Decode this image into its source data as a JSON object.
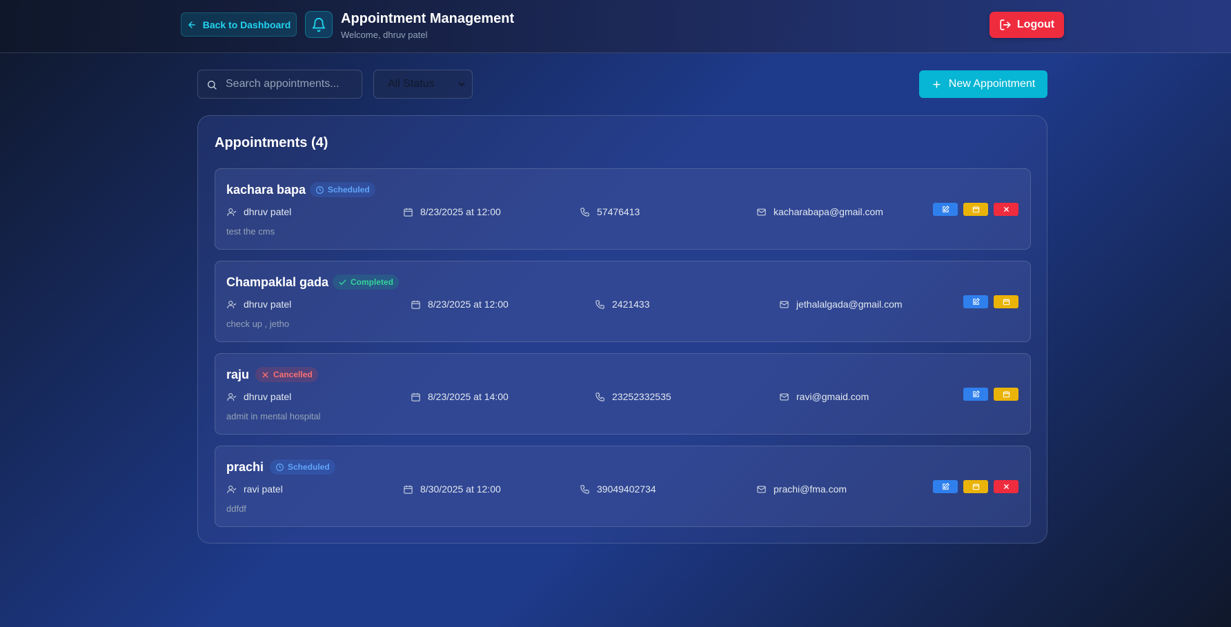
{
  "header": {
    "back_label": "Back to Dashboard",
    "title": "Appointment Management",
    "welcome": "Welcome, dhruv patel",
    "logout_label": "Logout"
  },
  "toolbar": {
    "search_placeholder": "Search appointments...",
    "status_selected": "All Status",
    "new_label": "New Appointment"
  },
  "list": {
    "title": "Appointments (4)",
    "items": [
      {
        "name": "kachara bapa",
        "status": "Scheduled",
        "doctor": "dhruv patel",
        "datetime": "8/23/2025 at 12:00",
        "phone": "57476413",
        "email": "kacharabapa@gmail.com",
        "note": "test the cms"
      },
      {
        "name": "Champaklal gada",
        "status": "Completed",
        "doctor": "dhruv patel",
        "datetime": "8/23/2025 at 12:00",
        "phone": "2421433",
        "email": "jethalalgada@gmail.com",
        "note": "check up , jetho"
      },
      {
        "name": "raju",
        "status": "Cancelled",
        "doctor": "dhruv patel",
        "datetime": "8/23/2025 at 14:00",
        "phone": "23252332535",
        "email": "ravi@gmaid.com",
        "note": "admit in mental hospital"
      },
      {
        "name": "prachi",
        "status": "Scheduled",
        "doctor": "ravi patel",
        "datetime": "8/30/2025 at 12:00",
        "phone": "39049402734",
        "email": "prachi@fma.com",
        "note": "ddfdf"
      }
    ]
  },
  "icons": {
    "back": "arrow-left-icon",
    "bell": "bell-icon",
    "logout": "logout-icon",
    "search": "search-icon",
    "new": "plus-icon",
    "scheduled": "clock-icon",
    "completed": "check-icon",
    "cancelled": "x-icon",
    "doctor": "user-icon",
    "date": "calendar-icon",
    "phone": "phone-icon",
    "email": "mail-icon",
    "edit": "edit-icon",
    "reschedule": "calendar-icon",
    "cancel": "x-icon"
  },
  "colors": {
    "accent": "#06b6d4",
    "danger": "#ef2b3e",
    "edit": "#2f80ed",
    "reschedule": "#eab308",
    "scheduled": "#60a5fa",
    "completed": "#34d399",
    "cancelled": "#f87171"
  }
}
